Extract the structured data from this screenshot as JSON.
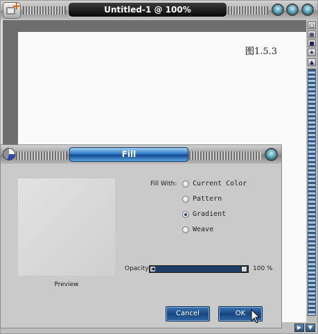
{
  "window": {
    "title": "Untitled-1 @ 100%",
    "document_text": "图1.5.3"
  },
  "dialog": {
    "title": "Fill",
    "preview_label": "Preview",
    "fill_with_label": "Fill With:",
    "options": [
      {
        "label": "Current Color",
        "selected": false
      },
      {
        "label": "Pattern",
        "selected": false
      },
      {
        "label": "Gradient",
        "selected": true
      },
      {
        "label": "Weave",
        "selected": false
      }
    ],
    "opacity_label": "Opacity",
    "opacity_value": "100 %",
    "opacity_level": 1.0,
    "cancel_label": "Cancel",
    "ok_label": "OK"
  },
  "icons": {
    "app": "new-document-icon",
    "dialog": "fill-bucket-icon",
    "cursor": "mouse-pointer-icon"
  },
  "colors": {
    "accent_blue": "#1d3c66",
    "button_blue": "#16477f",
    "title_gradient_blue": "#2f79c6"
  }
}
